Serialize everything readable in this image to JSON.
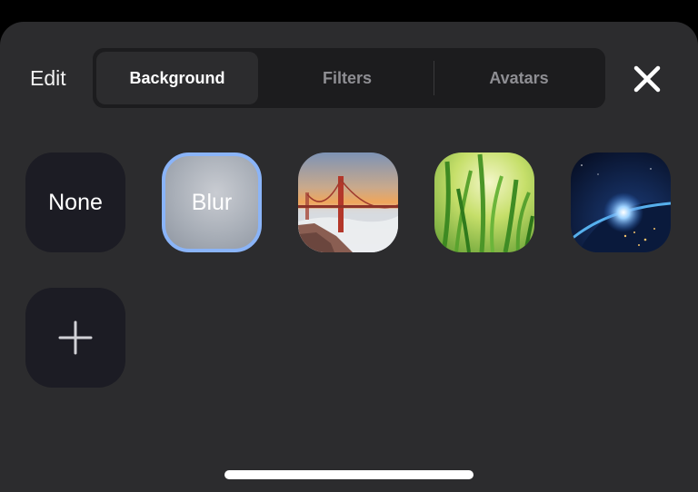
{
  "header": {
    "edit_label": "Edit",
    "close_icon": "close-icon"
  },
  "tabs": [
    {
      "label": "Background",
      "active": true
    },
    {
      "label": "Filters",
      "active": false
    },
    {
      "label": "Avatars",
      "active": false
    }
  ],
  "backgrounds": {
    "none_label": "None",
    "blur_label": "Blur",
    "selected": "Blur",
    "image_icons": [
      "golden-gate-bridge-image",
      "grass-image",
      "earth-from-space-image"
    ],
    "add_icon": "plus-icon"
  },
  "colors": {
    "accent_selected": "#8ab4f8",
    "sheet_background": "#2c2c2e",
    "segmented_background": "#1c1c1e"
  }
}
